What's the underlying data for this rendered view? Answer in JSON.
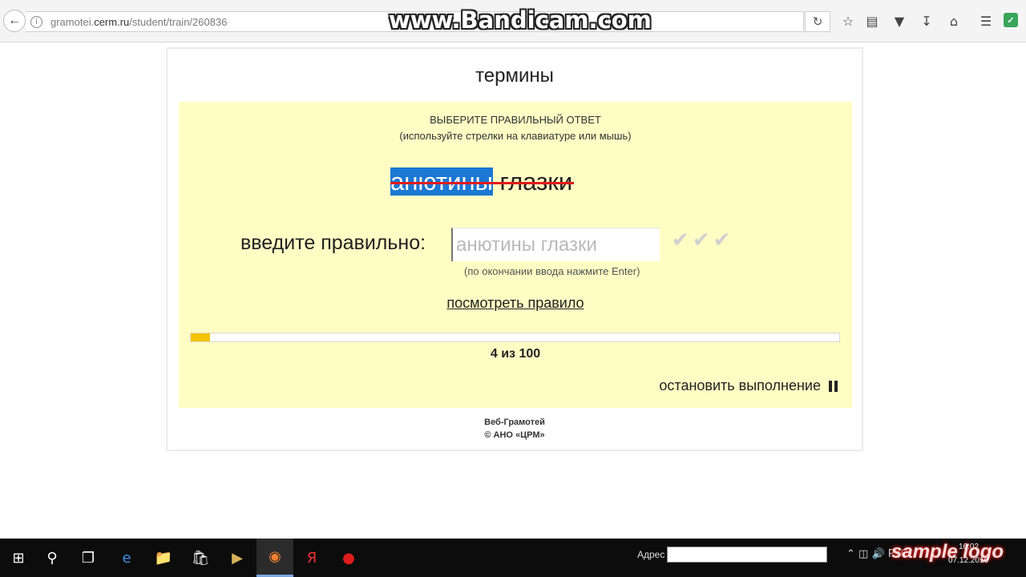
{
  "browser": {
    "url_prefix": "gramotei.",
    "url_domain": "cerm.ru",
    "url_path": "/student/train/260836",
    "watermark": "www.Bandicam.com"
  },
  "page": {
    "title": "термины",
    "instruction_line1": "ВЫБЕРИТЕ ПРАВИЛЬНЫЙ ОТВЕТ",
    "instruction_line2": "(используйте стрелки на клавиатуре или мышь)",
    "word_selected": "анютины",
    "word_rest": " глазки",
    "enter_label": "введите правильно:",
    "input_placeholder": "анютины глазки",
    "hint": "(по окончании ввода нажмите Enter)",
    "rule_link": "посмотреть правило",
    "progress_current": 4,
    "progress_total": 100,
    "counter_text": "4 из 100",
    "stop_label": "остановить выполнение",
    "footer_line1": "Веб-Грамотей",
    "footer_line2": "© АНО «ЦРМ»"
  },
  "taskbar": {
    "address_label": "Адрес",
    "keyboard_lang": "РУС",
    "clock_time": "16:02",
    "clock_date": "07.12.2016",
    "overlay_logo": "sample logo"
  },
  "colors": {
    "panel_bg": "#fffdc4",
    "selection": "#1b78d3",
    "strike": "#e21b1b",
    "progress_fill": "#f5c400"
  }
}
